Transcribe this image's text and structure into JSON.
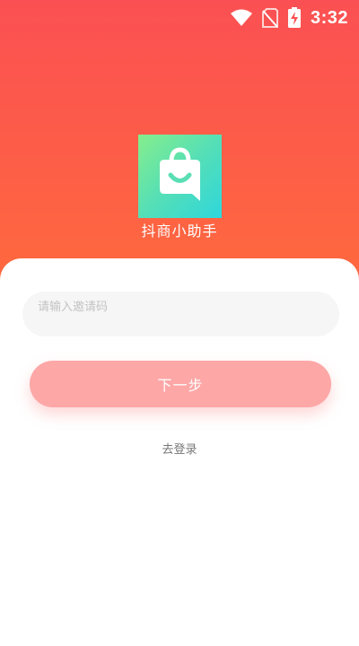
{
  "status_bar": {
    "time": "3:32",
    "icons": [
      "wifi-icon",
      "no-sim-icon",
      "battery-charging-icon"
    ]
  },
  "app": {
    "name": "抖商小助手",
    "logo_icon": "shopping-bag-chat-icon"
  },
  "form": {
    "invite_placeholder": "请输入邀请码",
    "invite_value": "",
    "next_label": "下一步",
    "login_link_label": "去登录"
  },
  "colors": {
    "header_gradient_top": "#fb5053",
    "header_gradient_bottom": "#ff6a3d",
    "logo_gradient_start": "#86ee8c",
    "logo_gradient_end": "#2fd6dc",
    "button_color": "#fda7a7",
    "input_background": "#f6f6f6"
  }
}
